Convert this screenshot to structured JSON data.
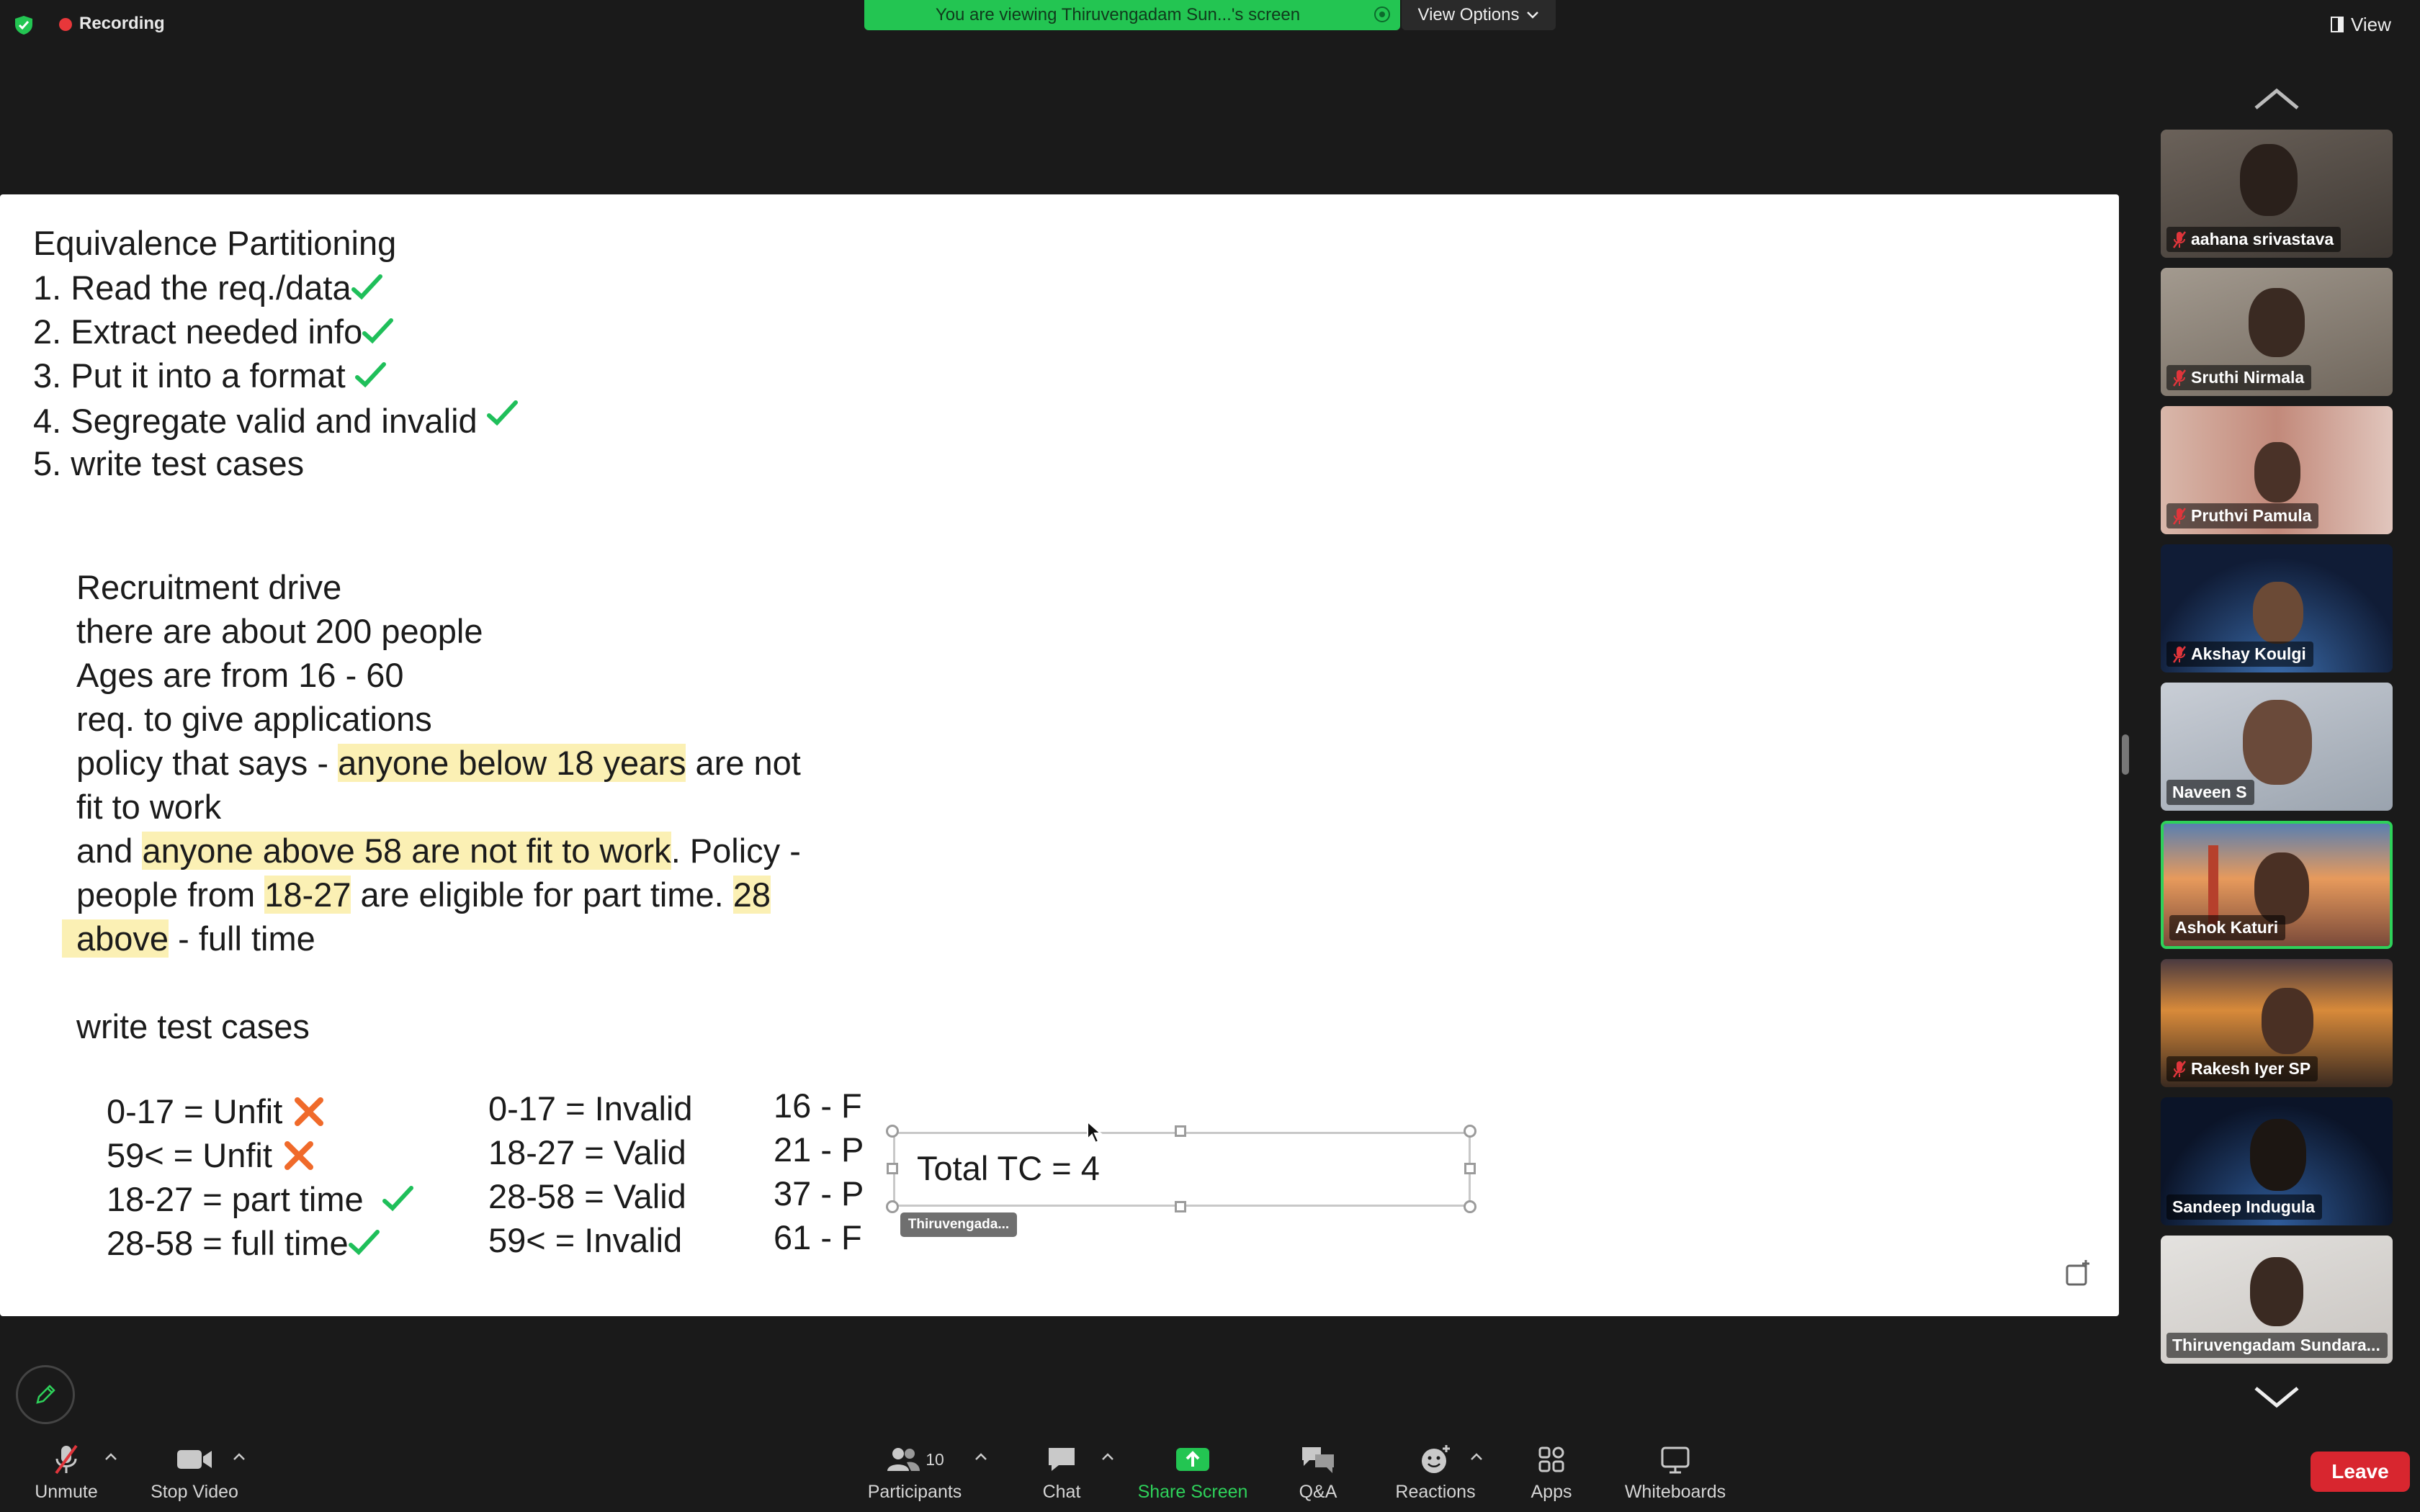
{
  "topbar": {
    "recording_label": "Recording",
    "viewing_banner": "You are viewing Thiruvengadam Sun...'s screen",
    "view_options_label": "View Options",
    "view_label": "View"
  },
  "slide": {
    "heading": "Equivalence Partitioning",
    "steps": [
      "1. Read the req./data",
      "2. Extract needed info",
      "3. Put it into a format",
      "4. Segregate valid and invalid",
      "5. write test cases"
    ],
    "story": {
      "l1": "Recruitment drive",
      "l2": "there are about 200 people",
      "l3": "Ages are from 16 - 60",
      "l4": "req. to give applications",
      "l5a": "policy that says - ",
      "l5b": "anyone below 18 years",
      "l5c": " are not",
      "l6": "fit to work",
      "l7a": "and ",
      "l7b": "anyone above 58 are not fit to work",
      "l7c": ". Policy -",
      "l8a": "people from ",
      "l8b": "18-27",
      "l8c": " are eligible for part time. ",
      "l8d": "28",
      "l9a": "above",
      "l9b": " - full time",
      "l10": "write test cases"
    },
    "col1": [
      "0-17 = Unfit",
      "59< = Unfit",
      "18-27 = part time",
      "28-58 = full time"
    ],
    "col2": [
      "0-17 = Invalid",
      "18-27 = Valid",
      "28-58 = Valid",
      "59< = Invalid"
    ],
    "col3": [
      "16 - F",
      "21 - P",
      "37 - P",
      "61 - F"
    ],
    "total_tc": "Total TC = 4",
    "textbox_owner": "Thiruvengada..."
  },
  "participants": [
    {
      "name": "aahana srivastava",
      "muted": true,
      "bg": "#5a5550"
    },
    {
      "name": "Sruthi Nirmala",
      "muted": true,
      "bg": "#8a7e70"
    },
    {
      "name": "Pruthvi Pamula",
      "muted": true,
      "bg": "#c79a8a"
    },
    {
      "name": "Akshay Koulgi",
      "muted": true,
      "bg": "#1c2a48"
    },
    {
      "name": "Naveen S",
      "muted": false,
      "bg": "#b9c1cc"
    },
    {
      "name": "Ashok Katuri",
      "muted": false,
      "bg": "#d0805a"
    },
    {
      "name": "Rakesh Iyer SP",
      "muted": true,
      "bg": "#8a5a34"
    },
    {
      "name": "Sandeep Indugula",
      "muted": false,
      "bg": "#12203a"
    },
    {
      "name": "Thiruvengadam Sundara...",
      "muted": false,
      "bg": "#d8d6d4"
    }
  ],
  "toolbar": {
    "unmute": "Unmute",
    "stop_video": "Stop Video",
    "participants": "Participants",
    "participants_count": "10",
    "chat": "Chat",
    "share_screen": "Share Screen",
    "qa": "Q&A",
    "reactions": "Reactions",
    "apps": "Apps",
    "whiteboards": "Whiteboards",
    "leave": "Leave"
  },
  "colors": {
    "share_green": "#23c552",
    "leave_red": "#d8262f",
    "highlight": "#fbf0b4",
    "check_green": "#1fbf5a",
    "x_orange": "#f06a2a"
  }
}
